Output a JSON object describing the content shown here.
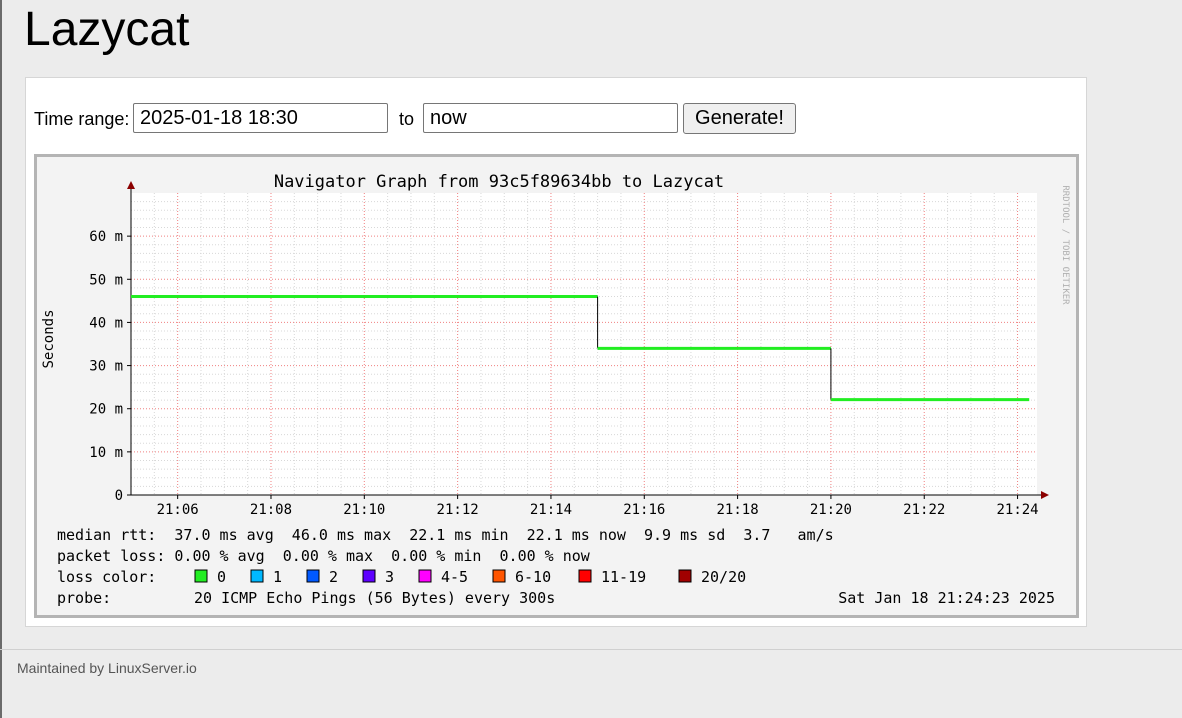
{
  "page": {
    "title": "Lazycat"
  },
  "form": {
    "time_range_label": "Time range:",
    "start_value": "2025-01-18 18:30",
    "to_label": "to",
    "end_value": "now",
    "generate_label": "Generate!"
  },
  "graph": {
    "watermark": "RRDTOOL / TOBI OETIKER",
    "stats": {
      "median_rtt": "median rtt:  37.0 ms avg  46.0 ms max  22.1 ms min  22.1 ms now  9.9 ms sd  3.7   am/s",
      "packet_loss": "packet loss: 0.00 % avg  0.00 % max  0.00 % min  0.00 % now",
      "loss_color_label": "loss color:",
      "probe_label": "probe:",
      "probe_value": "20 ICMP Echo Pings (56 Bytes) every 300s",
      "timestamp": "Sat Jan 18 21:24:23 2025"
    },
    "loss_legend": [
      {
        "label": "0",
        "color": "#22ee22"
      },
      {
        "label": "1",
        "color": "#00b8ff"
      },
      {
        "label": "2",
        "color": "#0059ff"
      },
      {
        "label": "3",
        "color": "#5e00ff"
      },
      {
        "label": "4-5",
        "color": "#ff00ff"
      },
      {
        "label": "6-10",
        "color": "#ff5500"
      },
      {
        "label": "11-19",
        "color": "#ff0000"
      },
      {
        "label": "20/20",
        "color": "#a10000"
      }
    ]
  },
  "chart_data": {
    "type": "line",
    "title": "Navigator Graph from 93c5f89634bb to Lazycat",
    "xlabel": "",
    "ylabel": "Seconds",
    "x_ticks": [
      "21:06",
      "21:08",
      "21:10",
      "21:12",
      "21:14",
      "21:16",
      "21:18",
      "21:20",
      "21:22",
      "21:24"
    ],
    "y_ticks": [
      "0",
      "10 m",
      "20 m",
      "30 m",
      "40 m",
      "50 m",
      "60 m"
    ],
    "xlim": [
      "21:05:00",
      "21:24:25"
    ],
    "ylim": [
      0,
      70
    ],
    "y_unit": "ms",
    "series": [
      {
        "color": "#22ee22",
        "step": true,
        "points": [
          {
            "x": "21:05:00",
            "y": 46.0
          },
          {
            "x": "21:15:00",
            "y": 34.0
          },
          {
            "x": "21:20:00",
            "y": 22.1
          },
          {
            "x": "21:24:15",
            "y": 22.1
          }
        ]
      }
    ],
    "grid": true,
    "line_color": "#22ee22",
    "grid_major_color": "#f08080",
    "grid_minor_color": "#d8d8d8"
  }
}
